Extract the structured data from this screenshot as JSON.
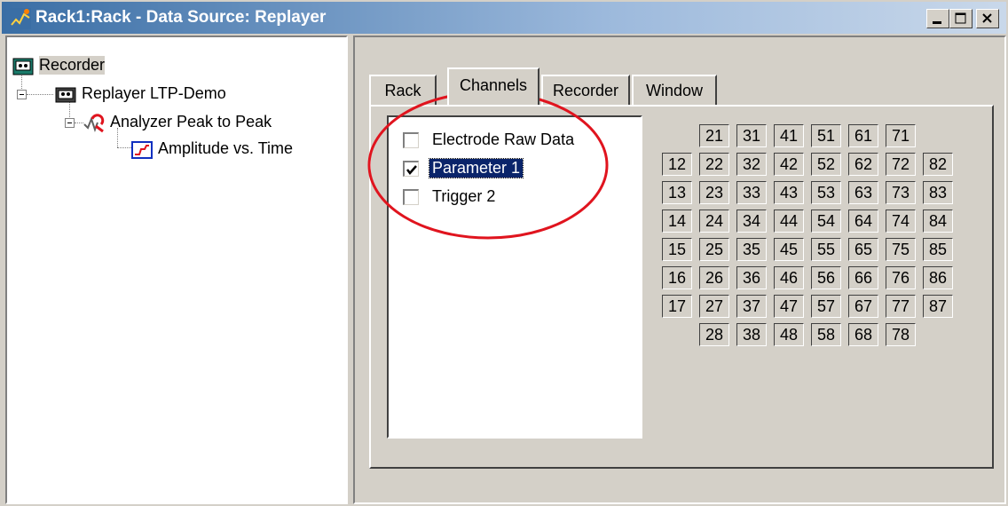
{
  "window": {
    "title": "Rack1:Rack - Data Source: Replayer",
    "controls": [
      "minimize-icon",
      "maximize-icon",
      "close-icon"
    ]
  },
  "tree": {
    "items": [
      {
        "label": "Recorder",
        "icon": "recorder-icon"
      },
      {
        "label": "Replayer LTP-Demo",
        "icon": "replayer-icon"
      },
      {
        "label": "Analyzer Peak to Peak",
        "icon": "analyzer-icon"
      },
      {
        "label": "Amplitude vs. Time",
        "icon": "chart-icon"
      }
    ]
  },
  "tabs": [
    {
      "label": "Rack",
      "active": false
    },
    {
      "label": "Channels",
      "active": true
    },
    {
      "label": "Recorder",
      "active": false
    },
    {
      "label": "Window",
      "active": false
    }
  ],
  "channels": [
    {
      "label": "Electrode Raw Data",
      "checked": false,
      "selected": false
    },
    {
      "label": "Parameter 1",
      "checked": true,
      "selected": true
    },
    {
      "label": "Trigger 2",
      "checked": false,
      "selected": false
    }
  ],
  "electrode_grid": [
    [
      "",
      "21",
      "31",
      "41",
      "51",
      "61",
      "71",
      ""
    ],
    [
      "12",
      "22",
      "32",
      "42",
      "52",
      "62",
      "72",
      "82"
    ],
    [
      "13",
      "23",
      "33",
      "43",
      "53",
      "63",
      "73",
      "83"
    ],
    [
      "14",
      "24",
      "34",
      "44",
      "54",
      "64",
      "74",
      "84"
    ],
    [
      "15",
      "25",
      "35",
      "45",
      "55",
      "65",
      "75",
      "85"
    ],
    [
      "16",
      "26",
      "36",
      "46",
      "56",
      "66",
      "76",
      "86"
    ],
    [
      "17",
      "27",
      "37",
      "47",
      "57",
      "67",
      "77",
      "87"
    ],
    [
      "",
      "28",
      "38",
      "48",
      "58",
      "68",
      "78",
      ""
    ]
  ],
  "colors": {
    "title_start": "#3a6ea5",
    "selection": "#0a246a",
    "annotation": "#e0141e",
    "face": "#d4d0c8"
  }
}
